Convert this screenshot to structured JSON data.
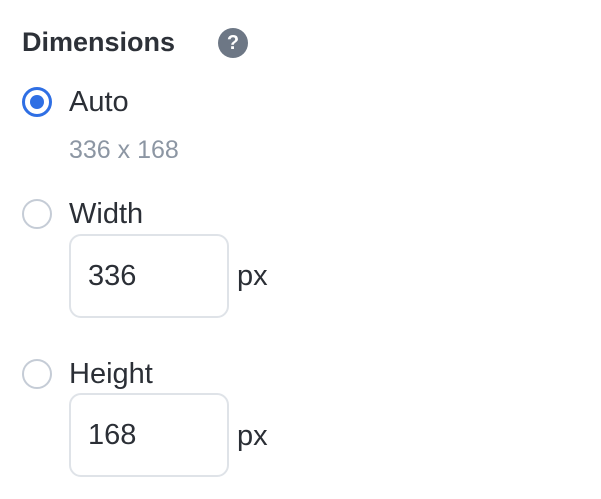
{
  "section": {
    "title": "Dimensions",
    "help_glyph": "?"
  },
  "options": {
    "auto": {
      "label": "Auto",
      "selected": true,
      "hint": "336 x 168"
    },
    "width": {
      "label": "Width",
      "selected": false,
      "value": "336",
      "unit": "px"
    },
    "height": {
      "label": "Height",
      "selected": false,
      "value": "168",
      "unit": "px"
    }
  },
  "colors": {
    "accent": "#2f6fe4",
    "help_icon_bg": "#6d7785",
    "hint_text": "#8c96a3"
  }
}
